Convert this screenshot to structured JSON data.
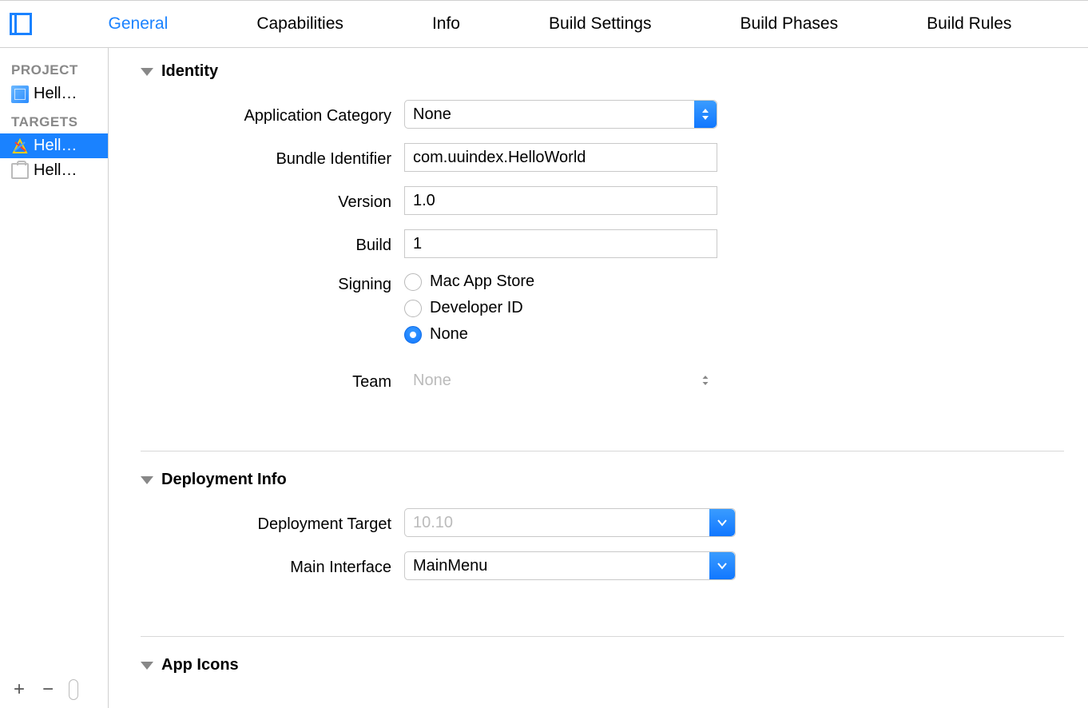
{
  "tabs": {
    "general": "General",
    "capabilities": "Capabilities",
    "info": "Info",
    "build_settings": "Build Settings",
    "build_phases": "Build Phases",
    "build_rules": "Build Rules"
  },
  "sidebar": {
    "project_heading": "PROJECT",
    "targets_heading": "TARGETS",
    "project_item": "Hell…",
    "target_app": "Hell…",
    "target_bundle": "Hell…"
  },
  "sections": {
    "identity": "Identity",
    "deployment": "Deployment Info",
    "app_icons": "App Icons"
  },
  "identity": {
    "app_category_label": "Application Category",
    "app_category_value": "None",
    "bundle_id_label": "Bundle Identifier",
    "bundle_id_value": "com.uuindex.HelloWorld",
    "version_label": "Version",
    "version_value": "1.0",
    "build_label": "Build",
    "build_value": "1",
    "signing_label": "Signing",
    "signing_options": {
      "mac_app_store": "Mac App Store",
      "developer_id": "Developer ID",
      "none": "None"
    },
    "signing_selected": "none",
    "team_label": "Team",
    "team_value": "None"
  },
  "deployment": {
    "target_label": "Deployment Target",
    "target_value": "10.10",
    "main_interface_label": "Main Interface",
    "main_interface_value": "MainMenu"
  }
}
